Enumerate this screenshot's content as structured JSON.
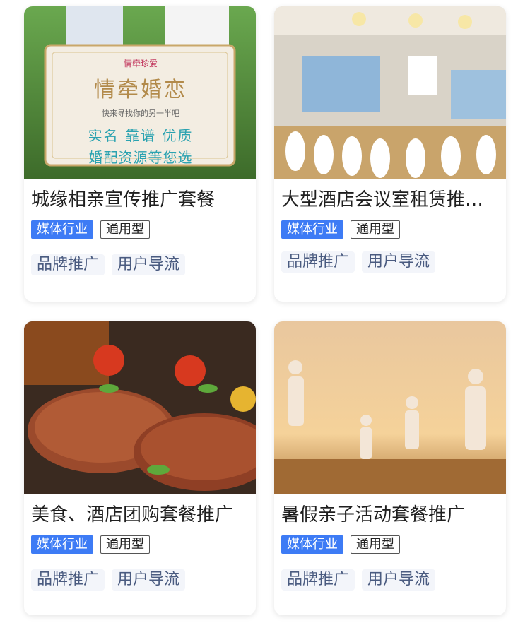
{
  "cards": [
    {
      "title": "城缘相亲宣传推广套餐",
      "tag_primary": "媒体行业",
      "tag_secondary": "通用型",
      "chips": [
        "品牌推广",
        "用户导流"
      ],
      "banner": {
        "brand": "情牵珍爱",
        "main": "情牵婚恋",
        "sub": "快来寻找你的另一半吧",
        "line1": "实名 靠谱 优质",
        "line2": "婚配资源等您选"
      }
    },
    {
      "title": "大型酒店会议室租赁推广…",
      "tag_primary": "媒体行业",
      "tag_secondary": "通用型",
      "chips": [
        "品牌推广",
        "用户导流"
      ]
    },
    {
      "title": "美食、酒店团购套餐推广",
      "tag_primary": "媒体行业",
      "tag_secondary": "通用型",
      "chips": [
        "品牌推广",
        "用户导流"
      ]
    },
    {
      "title": "暑假亲子活动套餐推广",
      "tag_primary": "媒体行业",
      "tag_secondary": "通用型",
      "chips": [
        "品牌推广",
        "用户导流"
      ]
    }
  ],
  "colors": {
    "tag_primary_bg": "#3D7BF5",
    "chip_bg": "#F3F5FA",
    "chip_text": "#4a5b80"
  }
}
